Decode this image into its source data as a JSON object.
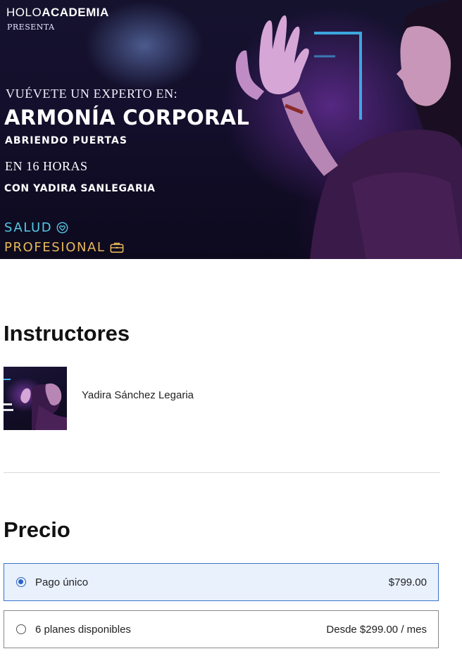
{
  "hero": {
    "brand_light": "HOLO",
    "brand_bold": "ACADEM",
    "brand_tail": "IA",
    "presenta": "PRESENTA",
    "tagline": "VUÉVETE UN EXPERTO EN:",
    "course_title": "ARMONÍA CORPORAL",
    "course_subtitle": "ABRIENDO PUERTAS",
    "duration": "EN 16 HORAS",
    "with_instructor": "CON YADIRA SANLEGARIA",
    "category_1": "SALUD",
    "category_1_icon": "heart-icon",
    "category_2": "PROFESIONAL",
    "category_2_icon": "briefcase-icon",
    "colors": {
      "salud": "#55c8e6",
      "profesional": "#e8b85a",
      "neon": "#3fb6f0"
    }
  },
  "instructors": {
    "heading": "Instructores",
    "items": [
      {
        "name": "Yadira Sánchez Legaria"
      }
    ]
  },
  "pricing": {
    "heading": "Precio",
    "options": [
      {
        "label": "Pago único",
        "price": "$799.00",
        "selected": true
      },
      {
        "label": "6 planes disponibles",
        "price": "Desde $299.00 / mes",
        "selected": false
      }
    ],
    "accent_color": "#2a64c8"
  }
}
